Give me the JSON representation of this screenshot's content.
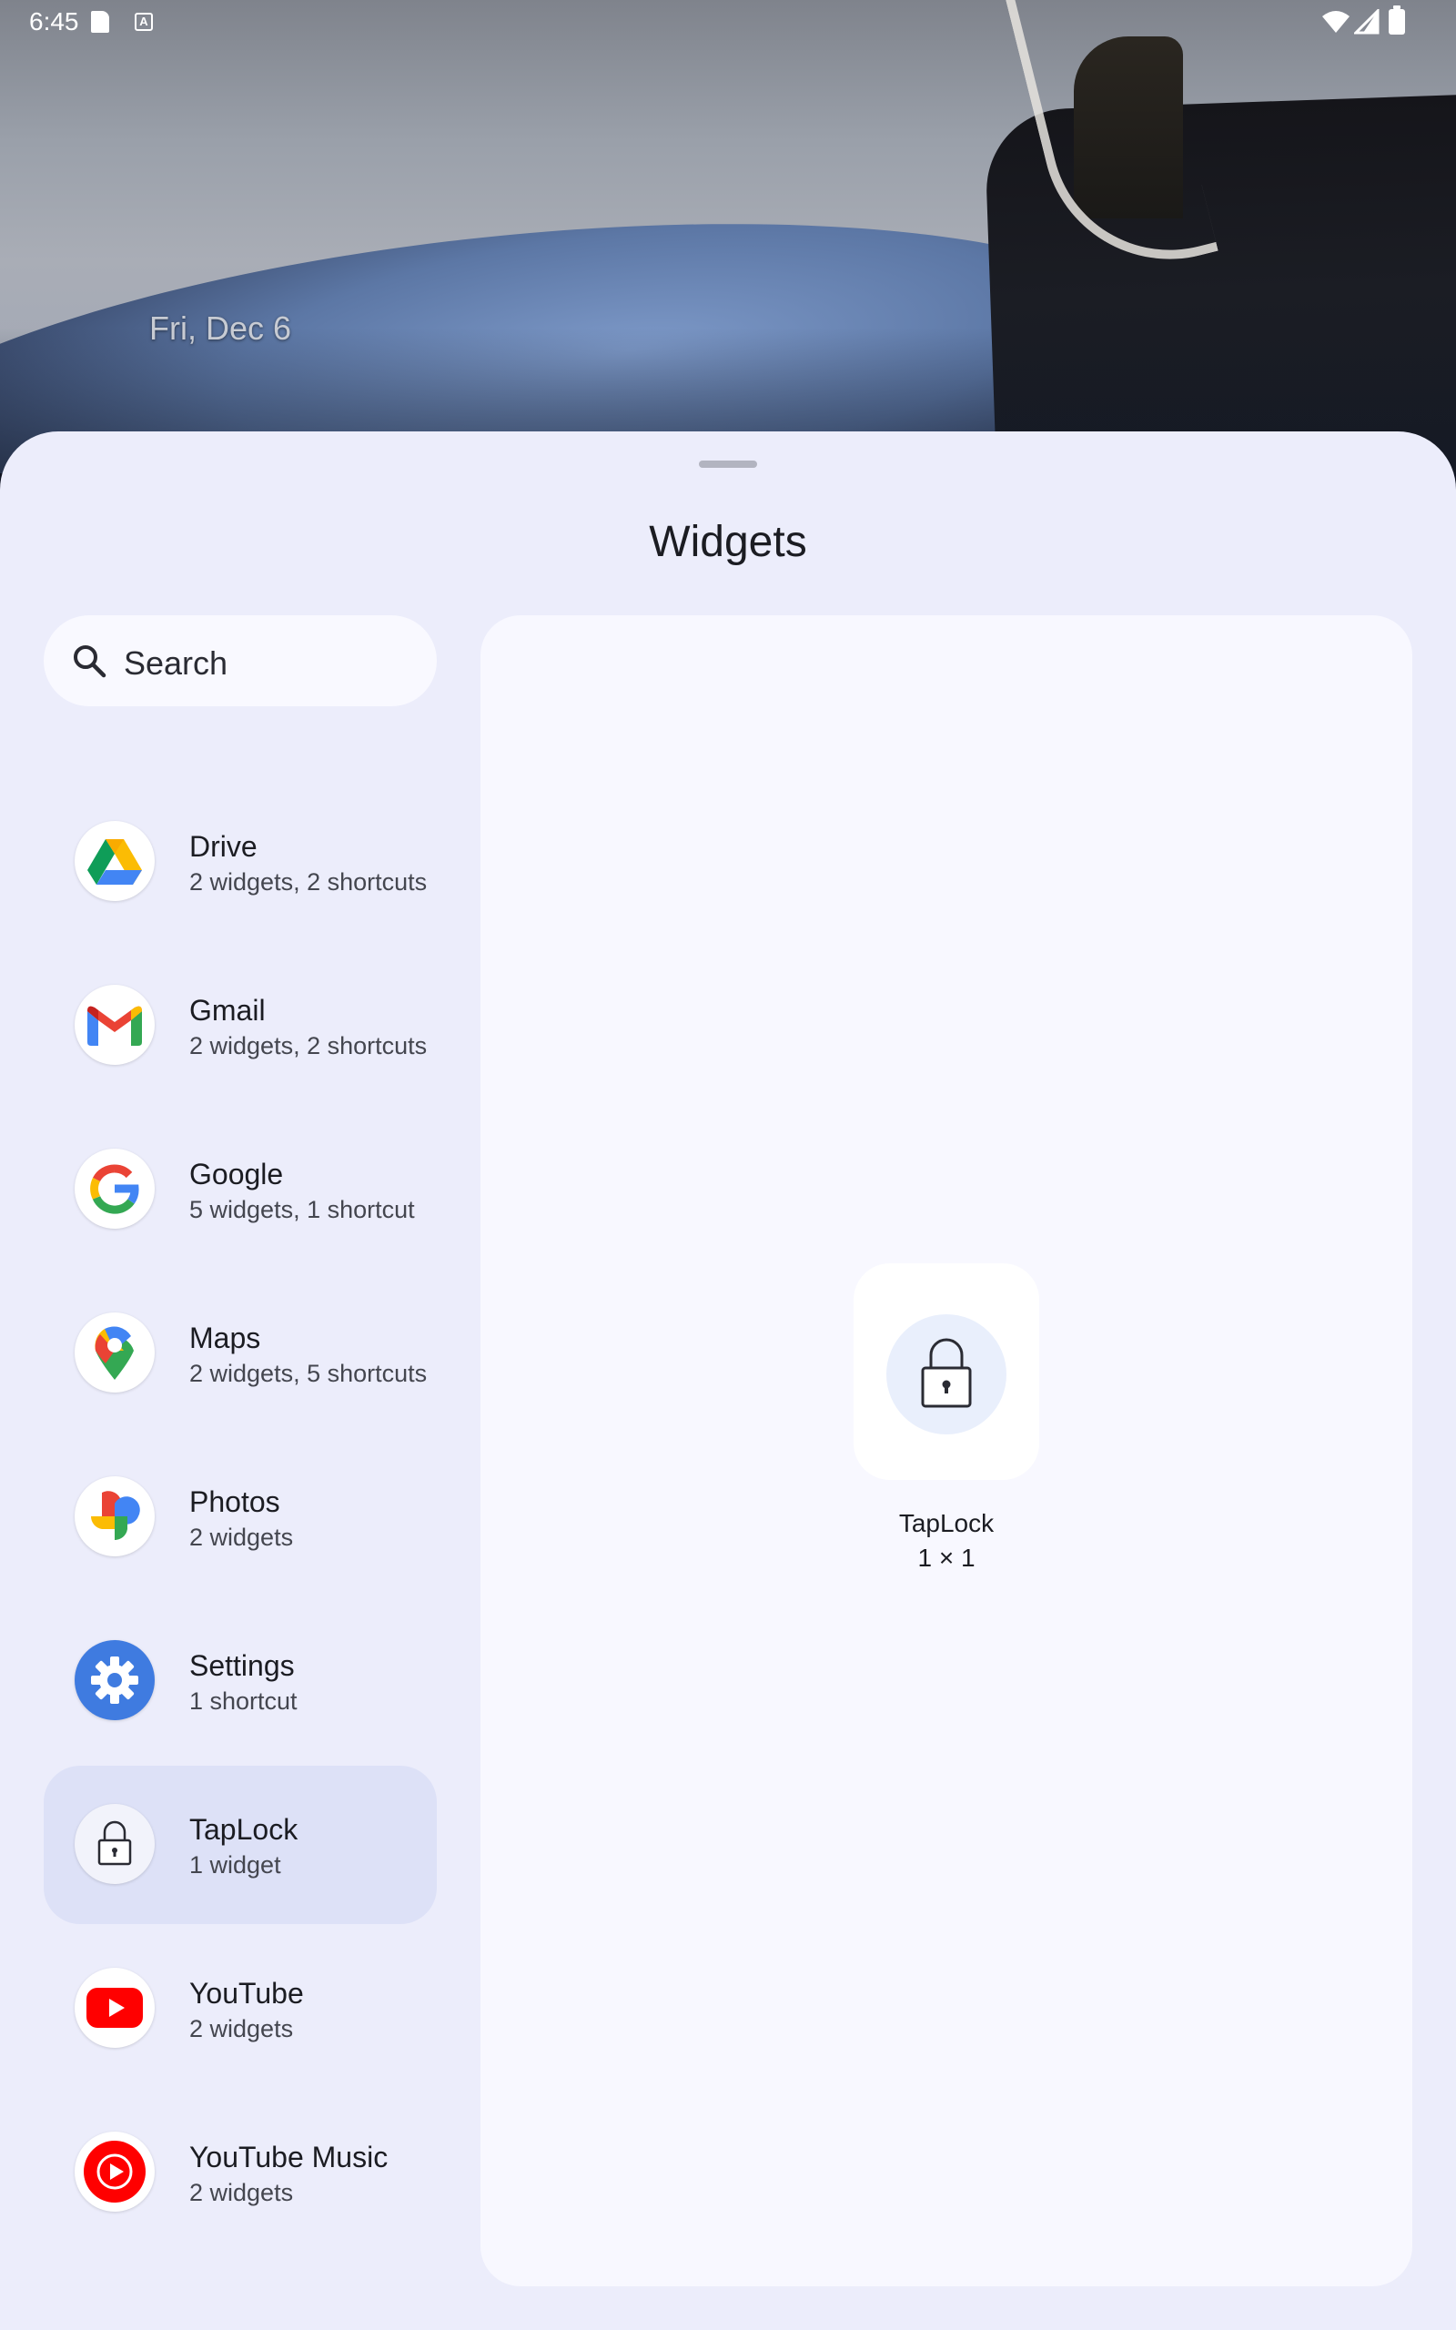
{
  "status_bar": {
    "time": "6:45",
    "icons": [
      "sd-card-icon",
      "a-icon",
      "wifi-icon",
      "signal-icon",
      "battery-icon"
    ]
  },
  "home": {
    "date": "Fri, Dec 6"
  },
  "sheet": {
    "title": "Widgets",
    "search": {
      "placeholder": "Search"
    }
  },
  "apps": [
    {
      "name": "Drive",
      "subtitle": "2 widgets, 2 shortcuts",
      "icon": "drive-icon"
    },
    {
      "name": "Gmail",
      "subtitle": "2 widgets, 2 shortcuts",
      "icon": "gmail-icon"
    },
    {
      "name": "Google",
      "subtitle": "5 widgets, 1 shortcut",
      "icon": "google-icon"
    },
    {
      "name": "Maps",
      "subtitle": "2 widgets, 5 shortcuts",
      "icon": "maps-icon"
    },
    {
      "name": "Photos",
      "subtitle": "2 widgets",
      "icon": "photos-icon"
    },
    {
      "name": "Settings",
      "subtitle": "1 shortcut",
      "icon": "settings-icon"
    },
    {
      "name": "TapLock",
      "subtitle": "1 widget",
      "icon": "lock-icon",
      "selected": true
    },
    {
      "name": "YouTube",
      "subtitle": "2 widgets",
      "icon": "youtube-icon"
    },
    {
      "name": "YouTube Music",
      "subtitle": "2 widgets",
      "icon": "youtube-music-icon"
    }
  ],
  "preview": {
    "widget_name": "TapLock",
    "widget_size": "1 × 1",
    "icon": "lock-icon"
  },
  "colors": {
    "sheet_bg": "#ecedfb",
    "panel_bg": "#f8f8ff",
    "selected_bg": "#dde1f7"
  }
}
